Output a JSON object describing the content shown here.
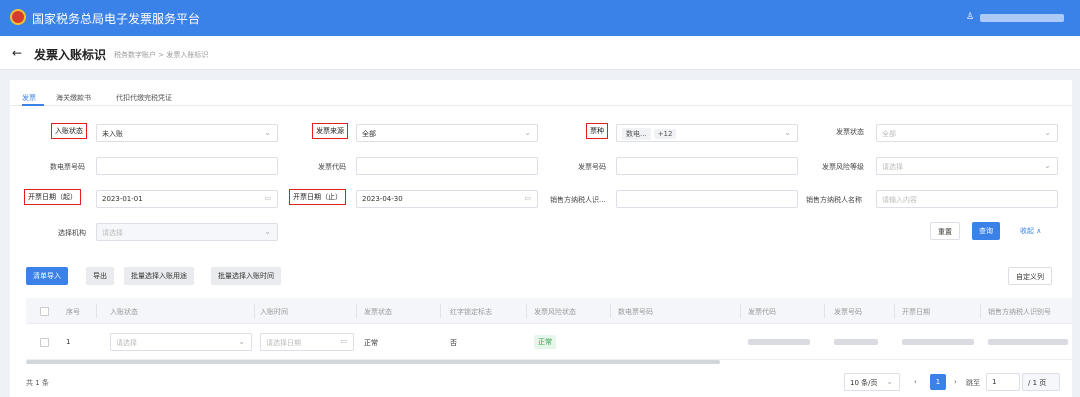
{
  "app_title": "国家税务总局电子发票服务平台",
  "user_icon": "user-icon",
  "page": {
    "back": "←",
    "title": "发票入账标识",
    "breadcrumb": "税务数字账户 > 发票入账标识"
  },
  "tabs": [
    "发票",
    "海关缴款书",
    "代扣代缴完税凭证"
  ],
  "filters": {
    "entry_status_label": "入账状态",
    "entry_status_value": "未入账",
    "invoice_source_label": "发票来源",
    "invoice_source_value": "全部",
    "ticket_type_label": "票种",
    "ticket_type_tag1": "数电...",
    "ticket_type_tag2": "+12",
    "invoice_status_label": "发票状态",
    "invoice_status_value": "全部",
    "einvoice_no_label": "数电票号码",
    "invoice_code_label": "发票代码",
    "invoice_no_label": "发票号码",
    "risk_level_label": "发票风险等级",
    "risk_level_placeholder": "请选择",
    "date_start_label": "开票日期（起）",
    "date_start_value": "2023-01-01",
    "date_end_label": "开票日期（止）",
    "date_end_value": "2023-04-30",
    "seller_id_label": "销售方纳税人识...",
    "seller_name_label": "销售方纳税人名称",
    "seller_name_placeholder": "请输入内容",
    "org_label": "选择机构",
    "org_placeholder": "请选择",
    "reset": "重置",
    "query": "查询",
    "collapse": "收起 ∧"
  },
  "toolbar": {
    "import": "清单导入",
    "export": "导出",
    "batch_use": "批量选择入账用途",
    "batch_time": "批量选择入账时间",
    "custom_cols": "自定义列"
  },
  "table": {
    "headers": [
      "序号",
      "入账状态",
      "入账时间",
      "发票状态",
      "红字锁定标志",
      "发票风险状态",
      "数电票号码",
      "发票代码",
      "发票号码",
      "开票日期",
      "销售方纳税人识别号"
    ],
    "row": {
      "index": "1",
      "entry_status_placeholder": "请选择",
      "entry_time_placeholder": "请选择日期",
      "invoice_status": "正常",
      "red_lock": "否",
      "risk_status": "正常"
    }
  },
  "pagination": {
    "total": "共 1 条",
    "page_size": "10 条/页",
    "prev": "‹",
    "current": "1",
    "next": "›",
    "goto_label": "跳至",
    "goto_value": "1",
    "pages": "/ 1 页"
  }
}
